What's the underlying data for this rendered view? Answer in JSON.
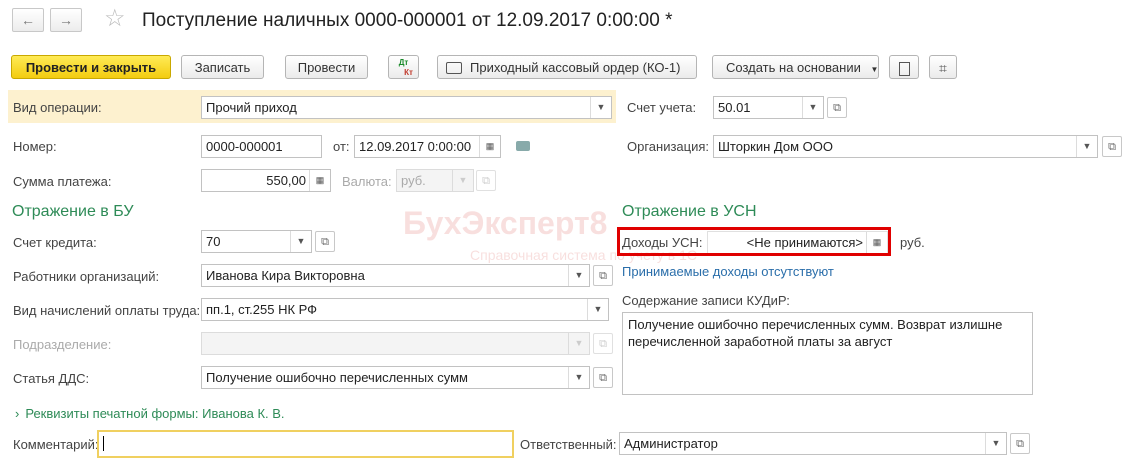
{
  "header": {
    "back_icon": "arrow-left-icon",
    "forward_icon": "arrow-right-icon",
    "favorite_icon": "star-icon",
    "title": "Поступление наличных 0000-000001 от 12.09.2017 0:00:00 *"
  },
  "toolbar": {
    "post_close": "Провести и закрыть",
    "save": "Записать",
    "post": "Провести",
    "dt_kt_top": "Дт",
    "dt_kt_bottom": "Кт",
    "print_order": "Приходный кассовый ордер (КО-1)",
    "create_based": "Создать на основании",
    "report_icon": "document-icon",
    "attach_icon": "paperclip-icon"
  },
  "form": {
    "operation_label": "Вид операции:",
    "operation_value": "Прочий приход",
    "account_label": "Счет учета:",
    "account_value": "50.01",
    "number_label": "Номер:",
    "number_value": "0000-000001",
    "date_label": "от:",
    "date_value": "12.09.2017  0:00:00",
    "org_label": "Организация:",
    "org_value": "Шторкин Дом ООО",
    "sum_label": "Сумма платежа:",
    "sum_value": "550,00",
    "currency_label": "Валюта:",
    "currency_value": "руб."
  },
  "bu": {
    "heading": "Отражение в БУ",
    "credit_label": "Счет кредита:",
    "credit_value": "70",
    "employee_label": "Работники организаций:",
    "employee_value": "Иванова Кира Викторовна",
    "payroll_label": "Вид начислений оплаты труда:",
    "payroll_value": "пп.1, ст.255 НК РФ",
    "division_label": "Подразделение:",
    "division_value": "",
    "dds_label": "Статья ДДС:",
    "dds_value": "Получение ошибочно перечисленных сумм"
  },
  "usn": {
    "heading": "Отражение в УСН",
    "income_label": "Доходы УСН:",
    "income_value": "<Не принимаются>",
    "income_unit": "руб.",
    "no_income_link": "Принимаемые доходы отсутствуют",
    "kudir_label": "Содержание записи КУДиР:",
    "kudir_text": "Получение ошибочно перечисленных сумм. Возврат излишне перечисленной заработной платы за август"
  },
  "footer": {
    "print_details": "Реквизиты печатной формы: Иванова К. В.",
    "comment_label": "Комментарий:",
    "comment_value": "",
    "responsible_label": "Ответственный:",
    "responsible_value": "Администратор"
  },
  "watermark": {
    "brand": "БухЭксперт8",
    "tagline": "Справочная система по учету в 1С"
  },
  "colors": {
    "primary_button": "#f3cc10",
    "section_heading": "#2e8b57",
    "link": "#2a6eaa",
    "highlight_row": "#fdf1cf",
    "callout": "#e00000"
  }
}
